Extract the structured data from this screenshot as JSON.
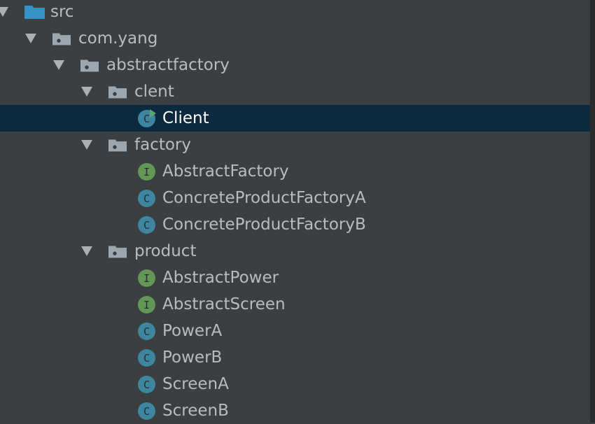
{
  "tree": [
    {
      "label": "src",
      "kind": "source-folder",
      "depth": 0,
      "expanded": true
    },
    {
      "label": "com.yang",
      "kind": "package",
      "depth": 1,
      "expanded": true
    },
    {
      "label": "abstractfactory",
      "kind": "package",
      "depth": 2,
      "expanded": true
    },
    {
      "label": "clent",
      "kind": "package",
      "depth": 3,
      "expanded": true
    },
    {
      "label": "Client",
      "kind": "runnable-class",
      "depth": 4,
      "selected": true
    },
    {
      "label": "factory",
      "kind": "package",
      "depth": 3,
      "expanded": true
    },
    {
      "label": "AbstractFactory",
      "kind": "interface",
      "depth": 4
    },
    {
      "label": "ConcreteProductFactoryA",
      "kind": "class",
      "depth": 4
    },
    {
      "label": "ConcreteProductFactoryB",
      "kind": "class",
      "depth": 4
    },
    {
      "label": "product",
      "kind": "package",
      "depth": 3,
      "expanded": true
    },
    {
      "label": "AbstractPower",
      "kind": "interface",
      "depth": 4
    },
    {
      "label": "AbstractScreen",
      "kind": "interface",
      "depth": 4
    },
    {
      "label": "PowerA",
      "kind": "class",
      "depth": 4
    },
    {
      "label": "PowerB",
      "kind": "class",
      "depth": 4
    },
    {
      "label": "ScreenA",
      "kind": "class",
      "depth": 4
    },
    {
      "label": "ScreenB",
      "kind": "class",
      "depth": 4
    }
  ],
  "icons": {
    "source-folder": "source-folder-icon",
    "package": "package-icon",
    "class": "class-icon",
    "interface": "interface-icon",
    "runnable-class": "runnable-class-icon",
    "arrow": "expand-arrow-icon"
  },
  "icon_letters": {
    "class": "C",
    "interface": "I"
  },
  "colors": {
    "background": "#3c3f41",
    "selection": "#0d293e",
    "text": "#bbbbbb",
    "selected_text": "#ffffff",
    "source_folder": "#3592c4",
    "package": "#9aa7b0",
    "class": "#3e86a0",
    "interface": "#629755",
    "run_marker": "#59a869",
    "arrow": "#a9b0b6"
  }
}
